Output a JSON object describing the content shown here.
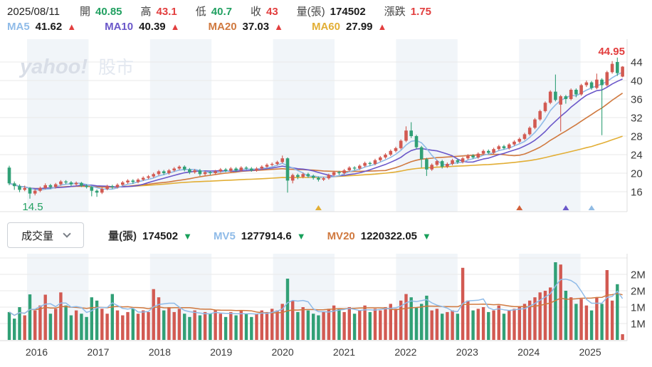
{
  "quote_bar": {
    "date": "2025/08/11",
    "fields": [
      {
        "label": "開",
        "value": "40.85",
        "color": "#21a061"
      },
      {
        "label": "高",
        "value": "43.1",
        "color": "#e23e3e"
      },
      {
        "label": "低",
        "value": "40.7",
        "color": "#21a061"
      },
      {
        "label": "收",
        "value": "43",
        "color": "#e23e3e"
      },
      {
        "label": "量(張)",
        "value": "174502",
        "color": "#1b1b1b"
      },
      {
        "label": "漲跌",
        "value": "1.75",
        "color": "#e23e3e"
      }
    ]
  },
  "ma_legend": {
    "items": [
      {
        "label": "MA5",
        "value": "41.62",
        "arrow": "▲",
        "label_color": "#8fbbe8",
        "arrow_color": "#e23e3e"
      },
      {
        "label": "MA10",
        "value": "40.39",
        "arrow": "▲",
        "label_color": "#6a57c9",
        "arrow_color": "#e23e3e"
      },
      {
        "label": "MA20",
        "value": "37.03",
        "arrow": "▲",
        "label_color": "#d0793f",
        "arrow_color": "#e23e3e"
      },
      {
        "label": "MA60",
        "value": "27.99",
        "arrow": "▲",
        "label_color": "#e2ae35",
        "arrow_color": "#e23e3e"
      }
    ]
  },
  "volume_controls": {
    "selector_label": "成交量",
    "items": [
      {
        "label": "量(張)",
        "value": "174502",
        "arrow": "▼",
        "label_color": "#333333",
        "arrow_color": "#18a05a"
      },
      {
        "label": "MV5",
        "value": "1277914.6",
        "arrow": "▼",
        "label_color": "#8fbbe8",
        "arrow_color": "#18a05a"
      },
      {
        "label": "MV20",
        "value": "1220322.05",
        "arrow": "▼",
        "label_color": "#d0793f",
        "arrow_color": "#18a05a"
      }
    ]
  },
  "watermark": {
    "brand": "yahoo!",
    "suffix": "股市"
  },
  "chart_data": {
    "type": "candlestick",
    "interval": "monthly",
    "start_month": "2015-09",
    "x_year_labels": [
      "2016",
      "2017",
      "2018",
      "2019",
      "2020",
      "2021",
      "2022",
      "2023",
      "2024",
      "2025"
    ],
    "price_axis": {
      "ticks": [
        16,
        20,
        24,
        28,
        32,
        36,
        40,
        44
      ],
      "high_label": "44.95",
      "low_label": "14.5",
      "high_value": 44.95,
      "low_value": 14.5
    },
    "volume_axis": {
      "ticks_m": [
        0.5,
        1.0,
        1.5,
        2.0,
        2.5
      ],
      "tick_labels": [
        "1M",
        "1M",
        "2M",
        "2M",
        ""
      ]
    },
    "candles": [
      [
        21.2,
        21.6,
        17.4,
        17.8
      ],
      [
        17.8,
        18.2,
        16.4,
        17.2
      ],
      [
        17.2,
        17.6,
        15.9,
        16.4
      ],
      [
        16.4,
        17.3,
        16.1,
        16.8
      ],
      [
        16.8,
        17.0,
        14.5,
        15.6
      ],
      [
        15.6,
        16.6,
        15.2,
        16.2
      ],
      [
        16.2,
        17.1,
        15.9,
        16.8
      ],
      [
        16.8,
        17.8,
        16.5,
        17.4
      ],
      [
        17.4,
        17.7,
        16.6,
        17.0
      ],
      [
        17.0,
        17.9,
        16.7,
        17.6
      ],
      [
        17.6,
        18.5,
        17.3,
        18.2
      ],
      [
        18.2,
        18.5,
        17.6,
        18.0
      ],
      [
        18.0,
        18.3,
        17.2,
        17.6
      ],
      [
        17.6,
        18.2,
        17.3,
        17.9
      ],
      [
        17.9,
        18.1,
        17.0,
        17.3
      ],
      [
        17.3,
        17.6,
        16.7,
        17.0
      ],
      [
        17.0,
        17.2,
        15.0,
        16.2
      ],
      [
        16.2,
        16.5,
        14.9,
        15.8
      ],
      [
        15.8,
        16.9,
        15.5,
        16.6
      ],
      [
        16.6,
        17.5,
        16.3,
        17.2
      ],
      [
        17.2,
        17.5,
        16.6,
        17.0
      ],
      [
        17.0,
        17.8,
        16.7,
        17.5
      ],
      [
        17.5,
        18.3,
        17.2,
        18.0
      ],
      [
        18.0,
        18.7,
        17.7,
        18.4
      ],
      [
        18.4,
        18.7,
        17.7,
        18.1
      ],
      [
        18.1,
        18.9,
        17.8,
        18.6
      ],
      [
        18.6,
        19.3,
        18.3,
        19.0
      ],
      [
        19.0,
        19.6,
        18.7,
        19.3
      ],
      [
        19.3,
        20.1,
        19.0,
        19.8
      ],
      [
        19.8,
        20.7,
        19.5,
        20.4
      ],
      [
        20.4,
        20.7,
        19.6,
        20.0
      ],
      [
        20.0,
        20.9,
        19.7,
        20.6
      ],
      [
        20.6,
        21.3,
        20.3,
        21.0
      ],
      [
        21.0,
        21.7,
        20.7,
        21.4
      ],
      [
        21.4,
        21.7,
        20.4,
        20.8
      ],
      [
        20.8,
        21.1,
        19.8,
        20.2
      ],
      [
        20.2,
        20.9,
        19.9,
        20.6
      ],
      [
        20.6,
        20.9,
        19.4,
        19.8
      ],
      [
        19.8,
        20.5,
        19.5,
        20.2
      ],
      [
        20.2,
        20.5,
        19.6,
        20.0
      ],
      [
        20.0,
        20.7,
        19.7,
        20.4
      ],
      [
        20.4,
        21.1,
        20.1,
        20.8
      ],
      [
        20.8,
        21.1,
        20.2,
        20.5
      ],
      [
        20.5,
        21.3,
        20.2,
        21.0
      ],
      [
        21.0,
        21.3,
        20.3,
        20.6
      ],
      [
        20.6,
        21.5,
        20.3,
        21.2
      ],
      [
        21.2,
        21.5,
        20.7,
        21.0
      ],
      [
        21.0,
        21.3,
        20.3,
        20.6
      ],
      [
        20.6,
        21.3,
        20.3,
        21.0
      ],
      [
        21.0,
        21.7,
        20.7,
        21.4
      ],
      [
        21.4,
        22.1,
        21.1,
        21.8
      ],
      [
        21.8,
        22.3,
        21.5,
        22.0
      ],
      [
        22.0,
        22.7,
        21.7,
        22.4
      ],
      [
        22.4,
        23.8,
        22.1,
        23.2
      ],
      [
        23.2,
        23.4,
        15.8,
        18.4
      ],
      [
        18.4,
        19.9,
        17.8,
        19.6
      ],
      [
        19.6,
        19.9,
        18.7,
        19.2
      ],
      [
        19.2,
        20.1,
        18.9,
        19.8
      ],
      [
        19.8,
        20.1,
        19.0,
        19.4
      ],
      [
        19.4,
        19.7,
        18.6,
        19.0
      ],
      [
        19.0,
        19.3,
        18.2,
        18.6
      ],
      [
        18.6,
        19.2,
        18.3,
        18.9
      ],
      [
        18.9,
        19.9,
        18.6,
        19.6
      ],
      [
        19.6,
        20.5,
        19.3,
        20.2
      ],
      [
        20.2,
        20.5,
        19.6,
        20.0
      ],
      [
        20.0,
        20.9,
        19.7,
        20.6
      ],
      [
        20.6,
        21.5,
        20.3,
        21.2
      ],
      [
        21.2,
        21.5,
        20.6,
        21.0
      ],
      [
        21.0,
        21.9,
        20.7,
        21.6
      ],
      [
        21.6,
        22.5,
        21.3,
        22.2
      ],
      [
        22.2,
        22.5,
        21.6,
        22.0
      ],
      [
        22.0,
        23.1,
        21.7,
        22.8
      ],
      [
        22.8,
        23.7,
        22.5,
        23.4
      ],
      [
        23.4,
        24.3,
        23.1,
        24.0
      ],
      [
        24.0,
        25.1,
        23.7,
        24.8
      ],
      [
        24.8,
        25.7,
        24.5,
        25.4
      ],
      [
        25.4,
        27.3,
        25.1,
        27.0
      ],
      [
        27.0,
        30.1,
        26.7,
        29.2
      ],
      [
        29.2,
        31.0,
        27.6,
        28.0
      ],
      [
        28.0,
        28.3,
        25.2,
        25.6
      ],
      [
        25.6,
        25.9,
        21.2,
        23.0
      ],
      [
        23.0,
        23.3,
        19.4,
        20.8
      ],
      [
        20.8,
        22.1,
        20.5,
        21.8
      ],
      [
        21.8,
        22.9,
        21.5,
        22.6
      ],
      [
        22.6,
        22.9,
        21.0,
        21.4
      ],
      [
        21.4,
        22.3,
        21.1,
        22.0
      ],
      [
        22.0,
        23.1,
        21.7,
        22.8
      ],
      [
        22.8,
        23.1,
        22.0,
        22.4
      ],
      [
        22.4,
        23.5,
        22.1,
        23.2
      ],
      [
        23.2,
        24.1,
        22.9,
        23.8
      ],
      [
        23.8,
        24.1,
        23.1,
        23.4
      ],
      [
        23.4,
        24.5,
        23.1,
        24.2
      ],
      [
        24.2,
        25.1,
        23.9,
        24.8
      ],
      [
        24.8,
        25.1,
        24.1,
        24.4
      ],
      [
        24.4,
        25.5,
        24.1,
        25.2
      ],
      [
        25.2,
        26.1,
        24.9,
        25.8
      ],
      [
        25.8,
        26.1,
        25.1,
        25.4
      ],
      [
        25.4,
        26.5,
        25.1,
        26.2
      ],
      [
        26.2,
        27.1,
        25.9,
        26.8
      ],
      [
        26.8,
        27.7,
        26.5,
        27.4
      ],
      [
        27.4,
        28.7,
        27.1,
        28.4
      ],
      [
        28.4,
        30.1,
        28.1,
        29.8
      ],
      [
        29.8,
        31.9,
        29.5,
        31.6
      ],
      [
        31.6,
        33.7,
        31.3,
        33.4
      ],
      [
        33.4,
        35.5,
        33.1,
        35.2
      ],
      [
        35.2,
        37.9,
        34.9,
        37.6
      ],
      [
        37.6,
        41.3,
        35.5,
        35.8
      ],
      [
        34.8,
        36.9,
        29.0,
        36.6
      ],
      [
        36.6,
        36.9,
        35.0,
        36.0
      ],
      [
        36.0,
        38.3,
        35.7,
        38.0
      ],
      [
        38.0,
        38.3,
        36.4,
        37.0
      ],
      [
        37.0,
        39.3,
        36.7,
        39.0
      ],
      [
        39.0,
        40.0,
        38.6,
        39.6
      ],
      [
        39.6,
        39.9,
        38.0,
        38.4
      ],
      [
        38.4,
        41.5,
        38.1,
        40.2
      ],
      [
        40.2,
        40.5,
        28.2,
        39.0
      ],
      [
        39.0,
        42.1,
        38.7,
        41.8
      ],
      [
        41.8,
        44.2,
        41.5,
        43.6
      ],
      [
        44.0,
        44.95,
        41.0,
        41.6
      ],
      [
        40.85,
        43.1,
        40.7,
        43.0
      ]
    ],
    "volumes_m": [
      0.85,
      0.65,
      1.0,
      0.75,
      1.39,
      0.9,
      1.05,
      1.38,
      0.8,
      0.95,
      1.45,
      1.05,
      0.75,
      0.9,
      0.8,
      0.7,
      1.3,
      1.2,
      0.95,
      0.8,
      1.4,
      0.9,
      0.75,
      0.85,
      0.95,
      0.8,
      0.9,
      0.85,
      1.55,
      1.3,
      0.9,
      1.0,
      0.85,
      0.95,
      0.8,
      0.7,
      0.9,
      0.75,
      0.85,
      0.8,
      0.9,
      0.8,
      0.7,
      0.85,
      0.75,
      0.9,
      0.8,
      0.7,
      0.8,
      0.9,
      0.85,
      0.95,
      0.9,
      1.1,
      1.87,
      1.2,
      0.85,
      1.0,
      0.9,
      0.8,
      0.75,
      0.85,
      0.95,
      1.05,
      0.95,
      0.85,
      1.0,
      0.8,
      0.9,
      1.05,
      0.85,
      0.95,
      0.9,
      1.0,
      1.1,
      0.95,
      1.2,
      1.4,
      1.3,
      1.0,
      1.1,
      1.35,
      0.9,
      0.95,
      0.8,
      0.85,
      0.9,
      0.8,
      2.2,
      1.2,
      0.9,
      0.95,
      1.0,
      0.85,
      0.9,
      1.05,
      0.8,
      0.9,
      0.95,
      1.0,
      1.1,
      1.2,
      1.3,
      1.45,
      1.5,
      1.6,
      2.37,
      2.3,
      1.5,
      1.3,
      1.1,
      1.25,
      1.05,
      0.9,
      1.3,
      1.1,
      2.13,
      1.2,
      1.7,
      0.1745
    ],
    "ma_periods": [
      60,
      20,
      10,
      5
    ],
    "mv_periods": [
      20,
      5
    ],
    "markers": [
      {
        "month_index": 60,
        "color": "#e2ae35"
      },
      {
        "month_index": 99,
        "color": "#d2603a"
      },
      {
        "month_index": 108,
        "color": "#6a57c9"
      },
      {
        "month_index": 113,
        "color": "#90bbe4"
      }
    ],
    "palette": {
      "up": "#d25a52",
      "down": "#31a076",
      "ma60": "#e2ae35",
      "ma20": "#d0793f",
      "ma10": "#6a57c9",
      "ma5": "#8fbbe8",
      "mv20": "#d0793f",
      "mv5": "#8fbbe8",
      "band": "#f1f5f9",
      "grid": "#e9e9e9",
      "border": "#dddddd",
      "axis_text": "#3a3a3a",
      "high_text": "#e23e3e",
      "low_text": "#21a061",
      "watermark_brand": "#d9dee7",
      "watermark_suffix": "#e3e8f0"
    }
  }
}
